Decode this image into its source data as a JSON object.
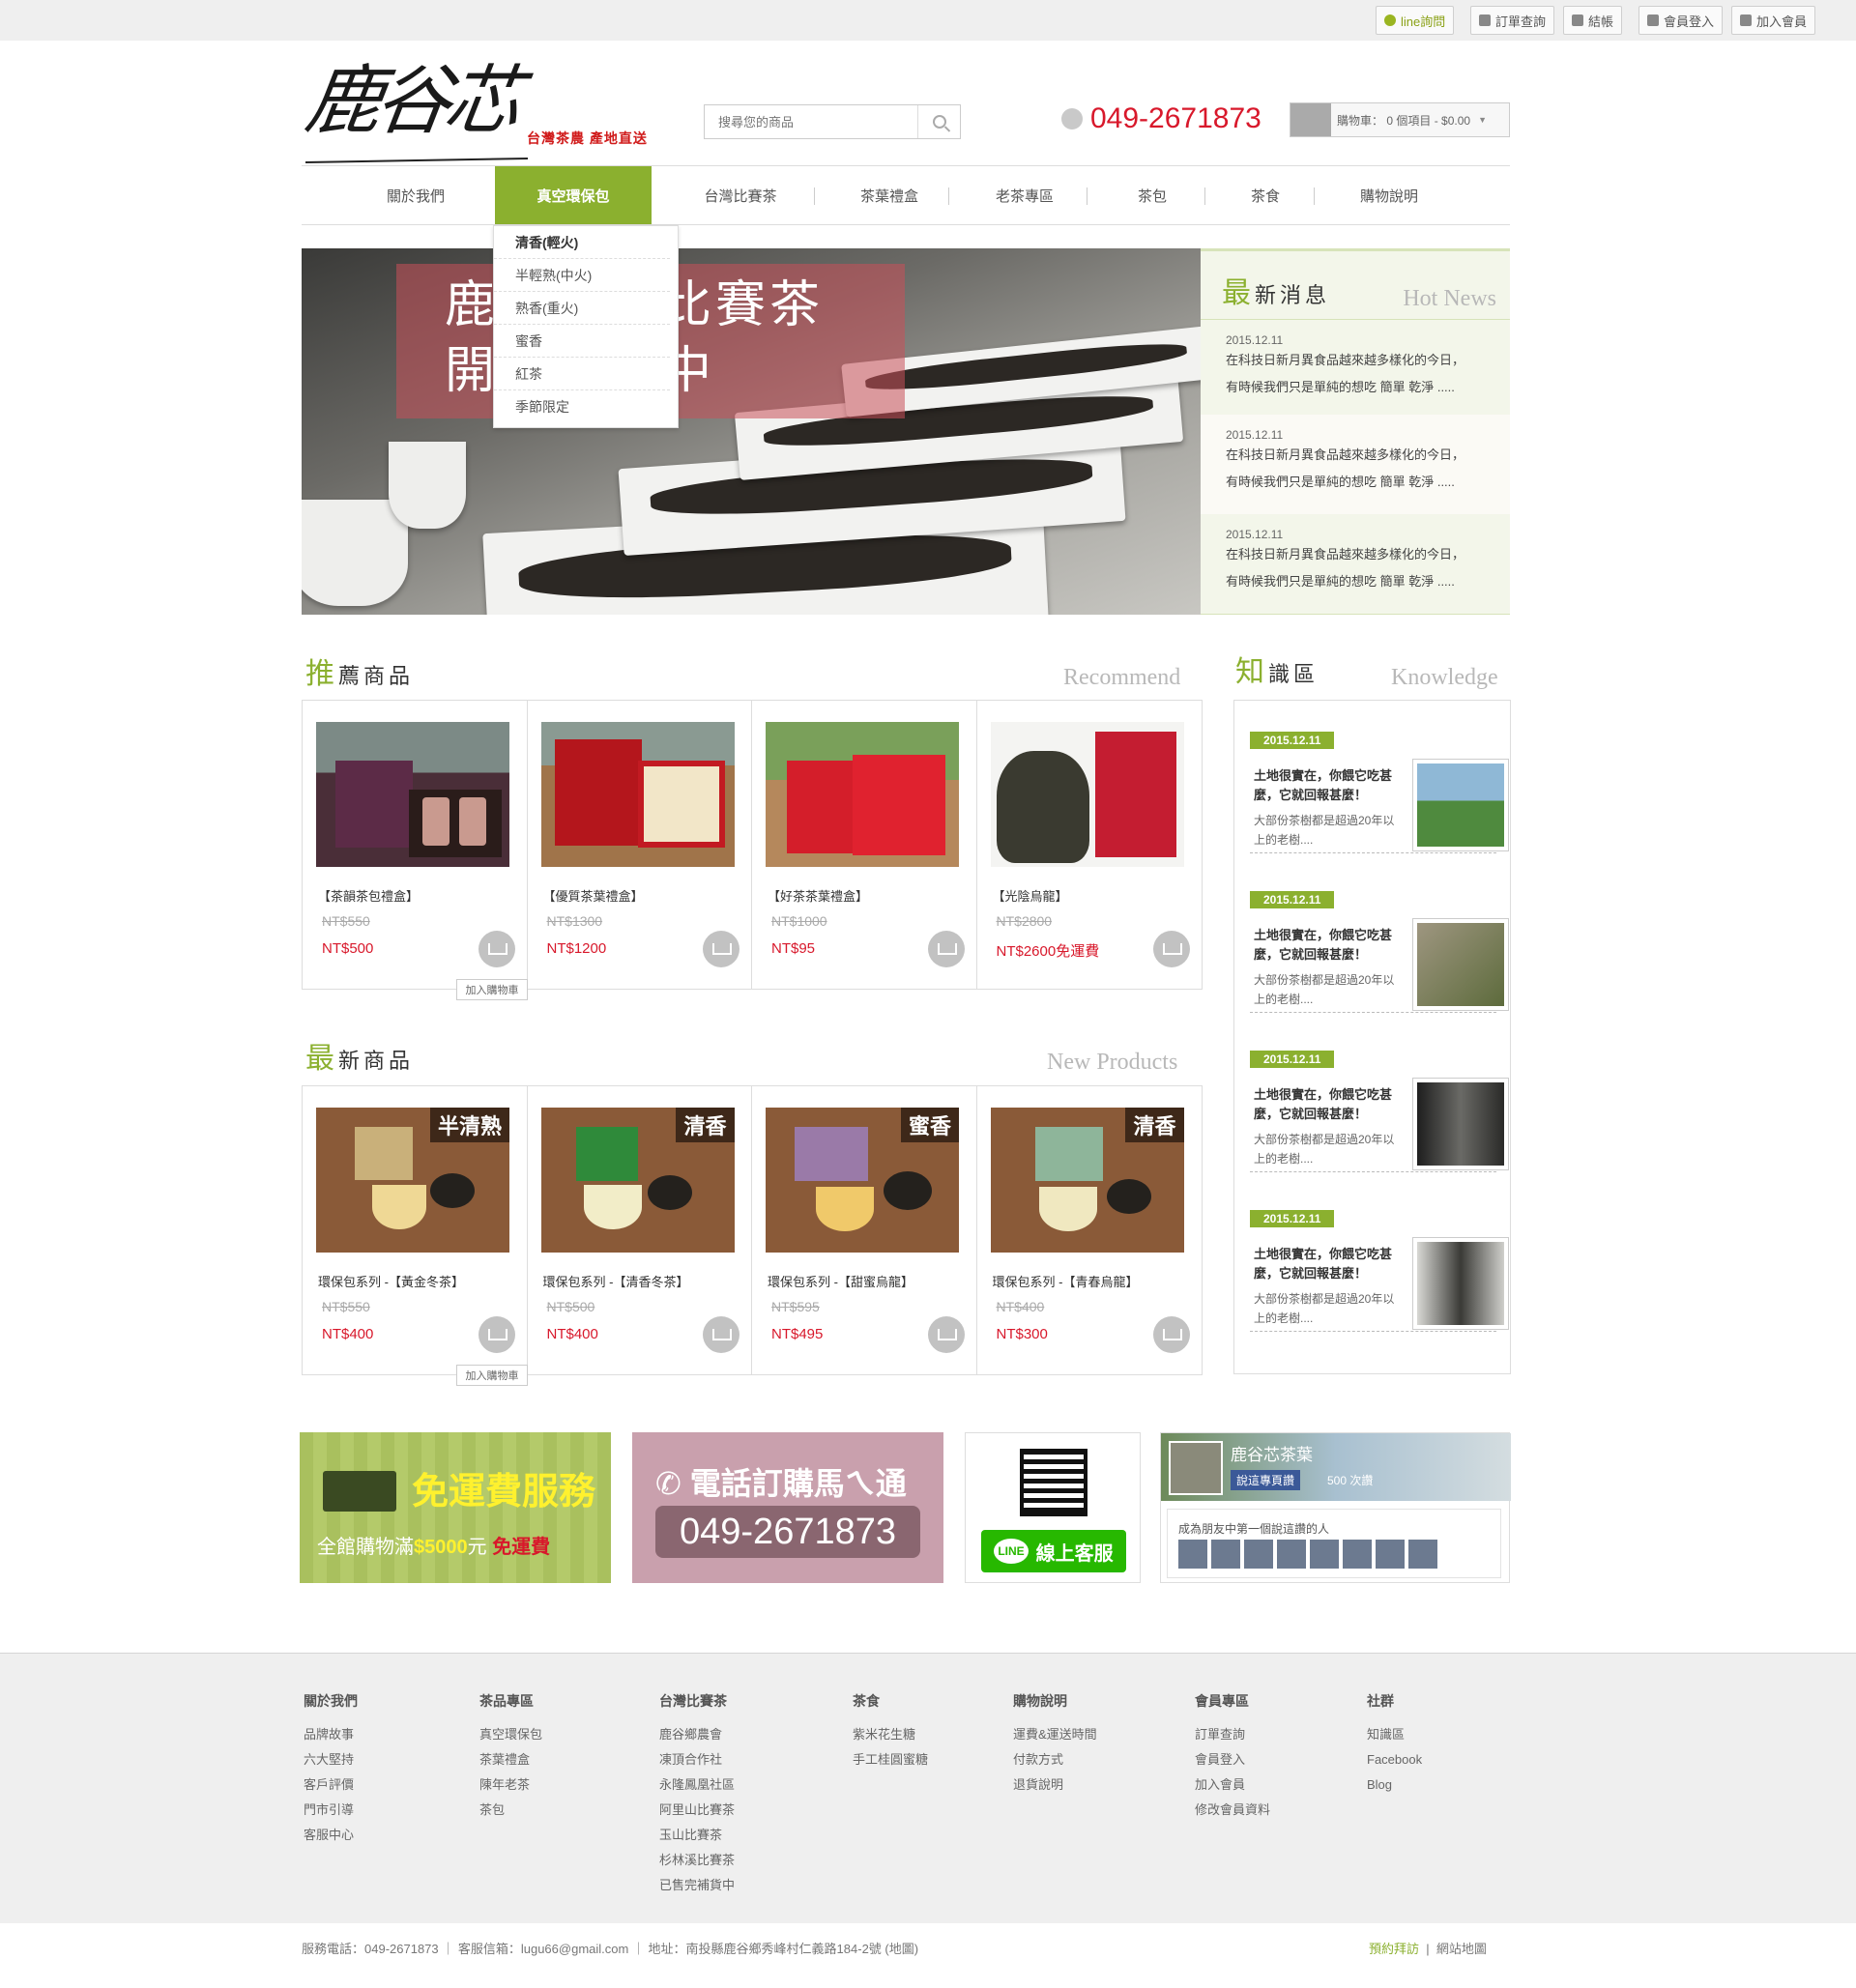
{
  "topbar": {
    "items": [
      {
        "label": "line詢問",
        "icon": "speech-bubble-icon"
      },
      {
        "label": "訂單查詢",
        "icon": "list-icon"
      },
      {
        "label": "結帳",
        "icon": "calculator-icon"
      },
      {
        "label": "會員登入",
        "icon": "lock-icon"
      },
      {
        "label": "加入會員",
        "icon": "user-icon"
      }
    ]
  },
  "header": {
    "logo_text": "鹿谷芯",
    "logo_sub": "台灣茶農 產地直送",
    "search_placeholder": "搜尋您的商品",
    "phone": "049-2671873",
    "cart_label": "購物車",
    "cart_summary": "0 個項目 - $0.00"
  },
  "nav": {
    "items": [
      "關於我們",
      "真空環保包",
      "台灣比賽茶",
      "茶葉禮盒",
      "老茶專區",
      "茶包",
      "茶食",
      "購物說明"
    ],
    "active": "真空環保包",
    "dropdown": [
      "清香(輕火)",
      "半輕熟(中火)",
      "熟香(重火)",
      "蜜香",
      "紅茶",
      "季節限定"
    ]
  },
  "banner": {
    "line1": "鹿谷冬季比賽茶",
    "line2": "開始熱購中"
  },
  "news": {
    "title_big": "最",
    "title_rest": "新消息",
    "title_en": "Hot News",
    "items": [
      {
        "date": "2015.12.11",
        "line1": "在科技日新月異食品越來越多樣化的今日，",
        "line2": "有時候我們只是單純的想吃 簡單 乾淨 ....."
      },
      {
        "date": "2015.12.11",
        "line1": "在科技日新月異食品越來越多樣化的今日，",
        "line2": "有時候我們只是單純的想吃 簡單 乾淨 ....."
      },
      {
        "date": "2015.12.11",
        "line1": "在科技日新月異食品越來越多樣化的今日，",
        "line2": "有時候我們只是單純的想吃 簡單 乾淨 ....."
      }
    ]
  },
  "recommend": {
    "title_big": "推",
    "title_rest": "薦商品",
    "title_en": "Recommend",
    "tooltip": "加入購物車",
    "items": [
      {
        "name": "【茶韻茶包禮盒】",
        "old": "NT$550",
        "price": "NT$500"
      },
      {
        "name": "【優質茶葉禮盒】",
        "old": "NT$1300",
        "price": "NT$1200"
      },
      {
        "name": "【好茶茶葉禮盒】",
        "old": "NT$1000",
        "price": "NT$95"
      },
      {
        "name": "【光陰烏龍】",
        "old": "NT$2800",
        "price": "NT$2600免運費"
      }
    ]
  },
  "newproducts": {
    "title_big": "最",
    "title_rest": "新商品",
    "title_en": "New Products",
    "tooltip": "加入購物車",
    "items": [
      {
        "tag": "半清熟",
        "name": "環保包系列 -【黃金冬茶】",
        "old": "NT$550",
        "price": "NT$400"
      },
      {
        "tag": "清香",
        "name": "環保包系列 -【清香冬茶】",
        "old": "NT$500",
        "price": "NT$400"
      },
      {
        "tag": "蜜香",
        "name": "環保包系列 -【甜蜜烏龍】",
        "old": "NT$595",
        "price": "NT$495"
      },
      {
        "tag": "清香",
        "name": "環保包系列 -【青春烏龍】",
        "old": "NT$400",
        "price": "NT$300"
      }
    ]
  },
  "knowledge": {
    "title_big": "知",
    "title_rest": "識區",
    "title_en": "Knowledge",
    "items": [
      {
        "date": "2015.12.11",
        "title": "土地很實在，你餵它吃甚麼，它就回報甚麼！",
        "desc": "大部份茶樹都是超過20年以上的老樹...."
      },
      {
        "date": "2015.12.11",
        "title": "土地很實在，你餵它吃甚麼，它就回報甚麼！",
        "desc": "大部份茶樹都是超過20年以上的老樹...."
      },
      {
        "date": "2015.12.11",
        "title": "土地很實在，你餵它吃甚麼，它就回報甚麼！",
        "desc": "大部份茶樹都是超過20年以上的老樹...."
      },
      {
        "date": "2015.12.11",
        "title": "土地很實在，你餵它吃甚麼，它就回報甚麼！",
        "desc": "大部份茶樹都是超過20年以上的老樹...."
      }
    ]
  },
  "promos": {
    "shipping_title": "免運費服務",
    "shipping_sub_a": "全館購物滿",
    "shipping_sub_amount": "$5000",
    "shipping_sub_b": "元",
    "shipping_sub_c": "免運費",
    "order_title": "電話訂購馬ㄟ通",
    "order_phone": "049-2671873",
    "line_label": "線上客服",
    "line_badge": "LINE",
    "fb_name": "鹿谷芯茶葉",
    "fb_like": "說這專頁讚",
    "fb_count": "500 次讚",
    "fb_friends": "成為朋友中第一個說這讚的人"
  },
  "footer": {
    "cols": [
      {
        "title": "關於我們",
        "links": [
          "品牌故事",
          "六大堅持",
          "客戶評價",
          "門市引導",
          "客服中心"
        ]
      },
      {
        "title": "茶品專區",
        "links": [
          "真空環保包",
          "茶葉禮盒",
          "陳年老茶",
          "茶包"
        ]
      },
      {
        "title": "台灣比賽茶",
        "links": [
          "鹿谷鄉農會",
          "凍頂合作社",
          "永隆鳳凰社區",
          "阿里山比賽茶",
          "玉山比賽茶",
          "杉林溪比賽茶",
          "已售完補貨中"
        ]
      },
      {
        "title": "茶食",
        "links": [
          "紫米花生糖",
          "手工桂圓蜜糖"
        ]
      },
      {
        "title": "購物說明",
        "links": [
          "運費&運送時間",
          "付款方式",
          "退貨說明"
        ]
      },
      {
        "title": "會員專區",
        "links": [
          "訂單查詢",
          "會員登入",
          "加入會員",
          "修改會員資料"
        ]
      },
      {
        "title": "社群",
        "links": [
          "知識區",
          "Facebook",
          "Blog"
        ]
      }
    ],
    "bottom_left": "服務電話：049-2671873 ｜ 客服信箱：lugu66@gmail.com ｜ 地址：南投縣鹿谷鄉秀峰村仁義路184-2號 (地圖)",
    "bottom_right_a": "預約拜訪",
    "bottom_right_b": "網站地圖"
  },
  "colors": {
    "accent": "#8bb02f",
    "price": "#d8182b",
    "phone": "#d8182b"
  }
}
